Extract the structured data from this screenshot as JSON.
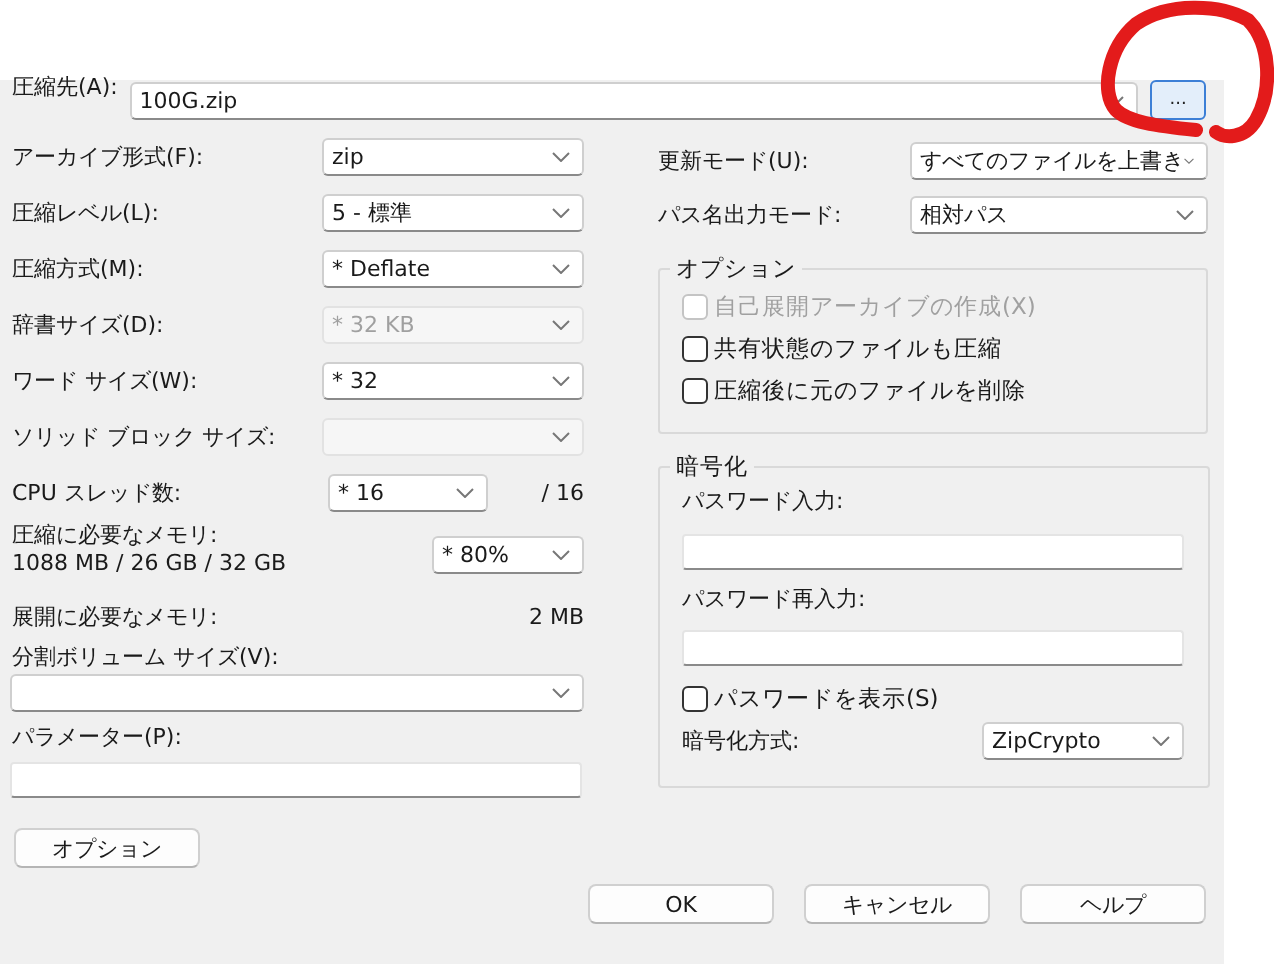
{
  "archive": {
    "label": "圧縮先(A):",
    "value": "100G.zip",
    "browse": "..."
  },
  "left_fields": [
    {
      "kind": "combo",
      "label": "アーカイブ形式(F):",
      "value": "zip",
      "disabled": false
    },
    {
      "kind": "combo",
      "label": "圧縮レベル(L):",
      "value": "5 - 標準",
      "disabled": false
    },
    {
      "kind": "combo",
      "label": "圧縮方式(M):",
      "value": "* Deflate",
      "disabled": false
    },
    {
      "kind": "combo",
      "label": "辞書サイズ(D):",
      "value": "* 32 KB",
      "disabled": true
    },
    {
      "kind": "combo",
      "label": "ワード サイズ(W):",
      "value": "* 32",
      "disabled": false
    },
    {
      "kind": "combo",
      "label": "ソリッド ブロック サイズ:",
      "disabled": true
    },
    {
      "kind": "short_combo",
      "label": "CPU スレッド数:",
      "value": "* 16",
      "suffix": "/ 16",
      "disabled": false
    }
  ],
  "memory": {
    "label": "圧縮に必要なメモリ:",
    "detail": "1088 MB / 26 GB / 32 GB",
    "value": "* 80%"
  },
  "decompress_memory": {
    "label": "展開に必要なメモリ:",
    "value": "2 MB"
  },
  "split": {
    "label": "分割ボリューム サイズ(V):"
  },
  "parameters": {
    "label": "パラメーター(P):"
  },
  "options_button": "オプション",
  "update_mode": {
    "label": "更新モード(U):",
    "value": "すべてのファイルを上書き"
  },
  "path_mode": {
    "label": "パス名出力モード:",
    "value": "相対パス"
  },
  "options": {
    "title": "オプション",
    "checkboxes": [
      {
        "label": "自己展開アーカイブの作成(X)",
        "checked": false,
        "disabled": true
      },
      {
        "label": "共有状態のファイルも圧縮",
        "checked": false,
        "disabled": false
      },
      {
        "label": "圧縮後に元のファイルを削除",
        "checked": false,
        "disabled": false
      }
    ]
  },
  "encryption": {
    "title": "暗号化",
    "password_label": "パスワード入力:",
    "reenter_label": "パスワード再入力:",
    "show_password": {
      "label": "パスワードを表示(S)",
      "checked": false
    },
    "method": {
      "label": "暗号化方式:",
      "value": "ZipCrypto"
    }
  },
  "buttons": [
    "OK",
    "キャンセル",
    "ヘルプ"
  ],
  "annotation": {
    "kind": "circle"
  }
}
